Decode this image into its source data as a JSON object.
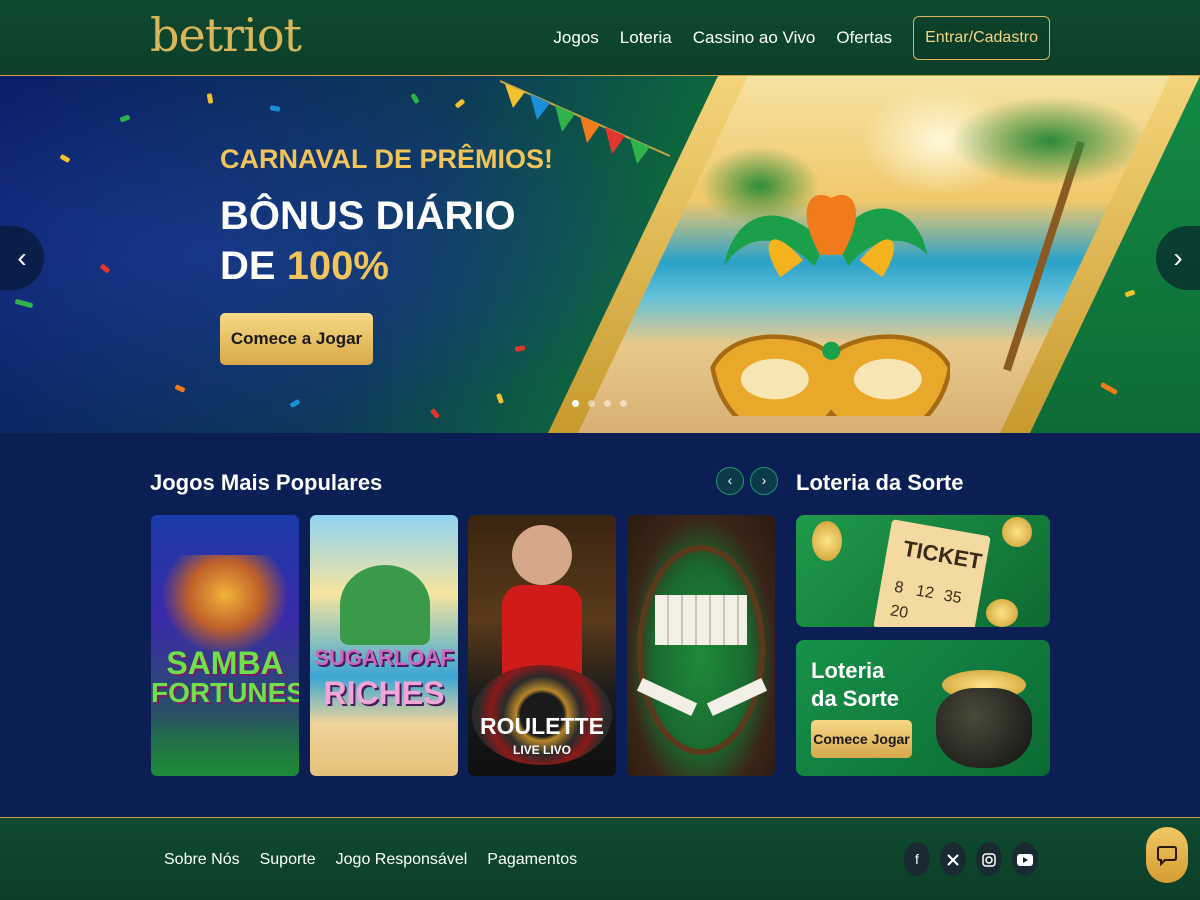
{
  "header": {
    "logo": "betriot",
    "nav": [
      "Jogos",
      "Loteria",
      "Cassino ao Vivo",
      "Ofertas"
    ],
    "login_label": "Entrar/Cadastro"
  },
  "hero": {
    "subtitle": "CARNAVAL DE PRÊMIOS!",
    "title_line1": "BÔNUS DIÁRIO",
    "title_line2_prefix": "DE ",
    "title_line2_highlight": "100%",
    "cta_label": "Comece a Jogar",
    "slide_count": 4,
    "active_slide": 1
  },
  "popular": {
    "title": "Jogos Mais Populares",
    "games": [
      {
        "title_line1": "SAMBA",
        "title_line2": "FORTUNES"
      },
      {
        "title_line1": "SUGARLOAF",
        "title_line2": "RICHES"
      },
      {
        "title_line1": "ROULETTE",
        "title_line2": "LIVE LIVO"
      },
      {
        "title_line1": "",
        "title_line2": ""
      }
    ]
  },
  "lottery": {
    "title": "Loteria da Sorte",
    "ticket_label": "TICKET",
    "ticket_numbers": [
      "8",
      "12",
      "35",
      "20"
    ],
    "promo_title_line1": "Loteria",
    "promo_title_line2": "da Sorte",
    "promo_cta": "Comece Jogar"
  },
  "footer": {
    "links": [
      "Sobre Nós",
      "Suporte",
      "Jogo Responsável",
      "Pagamentos"
    ],
    "socials": [
      "facebook-icon",
      "twitter-icon",
      "instagram-icon",
      "youtube-icon"
    ]
  },
  "colors": {
    "gold": "#d9b65a",
    "header_green": "#0e4a2f",
    "page_navy": "#0b1f55"
  }
}
